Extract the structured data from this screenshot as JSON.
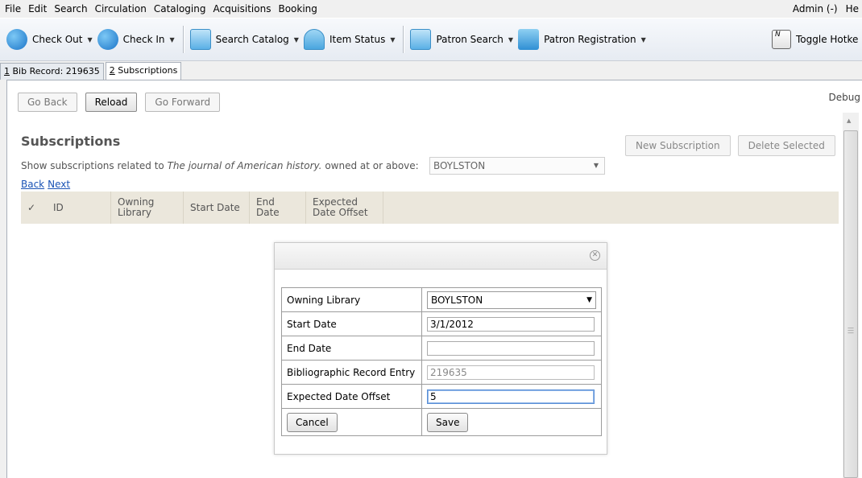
{
  "menubar": {
    "items": [
      "File",
      "Edit",
      "Search",
      "Circulation",
      "Cataloging",
      "Acquisitions",
      "Booking"
    ],
    "right": [
      "Admin (-)",
      "He"
    ]
  },
  "toolbar": {
    "check_out": "Check Out",
    "check_in": "Check In",
    "search_catalog": "Search Catalog",
    "item_status": "Item Status",
    "patron_search": "Patron Search",
    "patron_registration": "Patron Registration",
    "toggle_hotkeys": "Toggle Hotke",
    "hotkey_glyph": "N"
  },
  "tabs": [
    {
      "num": "1",
      "label": "Bib Record: 219635"
    },
    {
      "num": "2",
      "label": "Subscriptions"
    }
  ],
  "nav": {
    "back": "Go Back",
    "reload": "Reload",
    "forward": "Go Forward",
    "debug": "Debug"
  },
  "page": {
    "heading": "Subscriptions",
    "show_prefix": "Show subscriptions related to ",
    "show_title": "The journal of American history.",
    "show_suffix": " owned at or above:",
    "library_select": "BOYLSTON",
    "back_link": "Back",
    "next_link": "Next",
    "new_subscription": "New Subscription",
    "delete_selected": "Delete Selected"
  },
  "grid": {
    "check": "✓",
    "columns": [
      "ID",
      "Owning Library",
      "Start Date",
      "End Date",
      "Expected Date Offset"
    ]
  },
  "dialog": {
    "owning_library_label": "Owning Library",
    "owning_library_value": "BOYLSTON",
    "start_date_label": "Start Date",
    "start_date_value": "3/1/2012",
    "end_date_label": "End Date",
    "end_date_value": "",
    "bib_label": "Bibliographic Record Entry",
    "bib_value": "219635",
    "offset_label": "Expected Date Offset",
    "offset_value": "5",
    "cancel": "Cancel",
    "save": "Save"
  }
}
